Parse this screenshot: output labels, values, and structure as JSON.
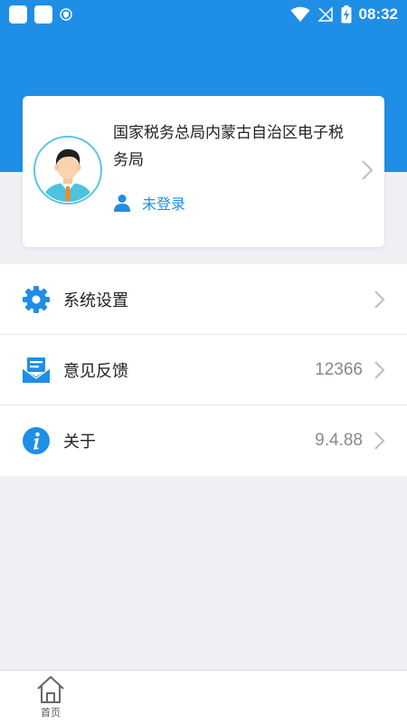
{
  "status_bar": {
    "time": "08:32"
  },
  "profile": {
    "org_name": "国家税务总局内蒙古自治区电子税务局",
    "login_status": "未登录"
  },
  "menu": {
    "items": [
      {
        "label": "系统设置",
        "value": "",
        "icon": "gear-icon"
      },
      {
        "label": "意见反馈",
        "value": "12366",
        "icon": "feedback-mail-icon"
      },
      {
        "label": "关于",
        "value": "9.4.88",
        "icon": "info-icon"
      }
    ]
  },
  "bottom_nav": {
    "home_label": "首页"
  },
  "colors": {
    "accent": "#1f8ee6",
    "background": "#efeff4"
  }
}
